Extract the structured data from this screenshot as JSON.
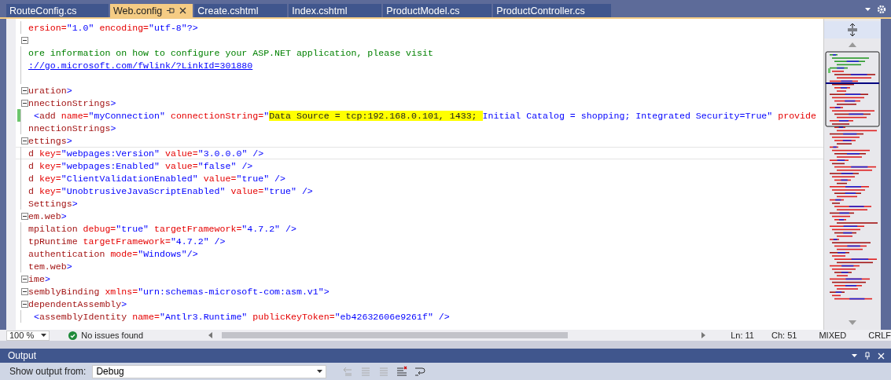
{
  "tabs": [
    {
      "label": "RouteConfig.cs",
      "selected": false
    },
    {
      "label": "Web.config",
      "selected": true
    },
    {
      "label": "Create.cshtml",
      "selected": false
    },
    {
      "label": "Index.cshtml",
      "selected": false
    },
    {
      "label": "ProductModel.cs",
      "selected": false
    },
    {
      "label": "ProductController.cs",
      "selected": false
    }
  ],
  "editor": {
    "lines": [
      {
        "fold": false,
        "changed": false,
        "current": false,
        "segments": [
          {
            "kind": "attr",
            "text": "ersion="
          },
          {
            "kind": "value",
            "text": "\"1.0\" "
          },
          {
            "kind": "attr",
            "text": "encoding="
          },
          {
            "kind": "value",
            "text": "\"utf-8\"?>"
          }
        ]
      },
      {
        "fold": true,
        "changed": false,
        "current": false
      },
      {
        "fold": false,
        "changed": false,
        "current": false,
        "segments": [
          {
            "kind": "comment",
            "text": "ore information on how to configure your ASP.NET application, please visit"
          }
        ]
      },
      {
        "fold": false,
        "changed": false,
        "current": false,
        "segments": [
          {
            "kind": "link",
            "text": "://go.microsoft.com/fwlink/?LinkId=301880"
          }
        ]
      },
      {
        "fold": false,
        "changed": false,
        "current": false
      },
      {
        "fold": true,
        "changed": false,
        "current": false,
        "segments": [
          {
            "kind": "tag",
            "text": "uration"
          },
          {
            "kind": "value",
            "text": ">"
          }
        ]
      },
      {
        "fold": true,
        "changed": false,
        "current": false,
        "segments": [
          {
            "kind": "tag",
            "text": "nnectionStrings"
          },
          {
            "kind": "value",
            "text": ">"
          }
        ]
      },
      {
        "fold": false,
        "changed": true,
        "current": false,
        "segments": [
          {
            "kind": "value",
            "text": " <"
          },
          {
            "kind": "tag",
            "text": "add "
          },
          {
            "kind": "attr",
            "text": "name="
          },
          {
            "kind": "value",
            "text": "\"myConnection\" "
          },
          {
            "kind": "attr",
            "text": "connectionString="
          },
          {
            "kind": "value",
            "text": "\""
          },
          {
            "kind": "highlight",
            "text": "Data Source = tcp:192.168.0.101, 1433; "
          },
          {
            "kind": "value",
            "text": "Initial Catalog = shopping; Integrated Security=True\" "
          },
          {
            "kind": "attr",
            "text": "provide"
          }
        ]
      },
      {
        "fold": false,
        "changed": false,
        "current": false,
        "segments": [
          {
            "kind": "tag",
            "text": "nnectionStrings"
          },
          {
            "kind": "value",
            "text": ">"
          }
        ]
      },
      {
        "fold": true,
        "changed": false,
        "current": false,
        "segments": [
          {
            "kind": "tag",
            "text": "ettings"
          },
          {
            "kind": "value",
            "text": ">"
          }
        ]
      },
      {
        "fold": false,
        "changed": false,
        "current": true,
        "segments": [
          {
            "kind": "tag",
            "text": "d "
          },
          {
            "kind": "attr",
            "text": "key="
          },
          {
            "kind": "value",
            "text": "\"webpages:Version\" "
          },
          {
            "kind": "attr",
            "text": "value="
          },
          {
            "kind": "value",
            "text": "\"3.0.0.0\" />"
          }
        ]
      },
      {
        "fold": false,
        "changed": false,
        "current": false,
        "segments": [
          {
            "kind": "tag",
            "text": "d "
          },
          {
            "kind": "attr",
            "text": "key="
          },
          {
            "kind": "value",
            "text": "\"webpages:Enabled\" "
          },
          {
            "kind": "attr",
            "text": "value="
          },
          {
            "kind": "value",
            "text": "\"false\" />"
          }
        ]
      },
      {
        "fold": false,
        "changed": false,
        "current": false,
        "segments": [
          {
            "kind": "tag",
            "text": "d "
          },
          {
            "kind": "attr",
            "text": "key="
          },
          {
            "kind": "value",
            "text": "\"ClientValidationEnabled\" "
          },
          {
            "kind": "attr",
            "text": "value="
          },
          {
            "kind": "value",
            "text": "\"true\" />"
          }
        ]
      },
      {
        "fold": false,
        "changed": false,
        "current": false,
        "segments": [
          {
            "kind": "tag",
            "text": "d "
          },
          {
            "kind": "attr",
            "text": "key="
          },
          {
            "kind": "value",
            "text": "\"UnobtrusiveJavaScriptEnabled\" "
          },
          {
            "kind": "attr",
            "text": "value="
          },
          {
            "kind": "value",
            "text": "\"true\" />"
          }
        ]
      },
      {
        "fold": false,
        "changed": false,
        "current": false,
        "segments": [
          {
            "kind": "tag",
            "text": "Settings"
          },
          {
            "kind": "value",
            "text": ">"
          }
        ]
      },
      {
        "fold": true,
        "changed": false,
        "current": false,
        "segments": [
          {
            "kind": "tag",
            "text": "em.web"
          },
          {
            "kind": "value",
            "text": ">"
          }
        ]
      },
      {
        "fold": false,
        "changed": false,
        "current": false,
        "segments": [
          {
            "kind": "tag",
            "text": "mpilation "
          },
          {
            "kind": "attr",
            "text": "debug="
          },
          {
            "kind": "value",
            "text": "\"true\" "
          },
          {
            "kind": "attr",
            "text": "targetFramework="
          },
          {
            "kind": "value",
            "text": "\"4.7.2\" />"
          }
        ]
      },
      {
        "fold": false,
        "changed": false,
        "current": false,
        "segments": [
          {
            "kind": "tag",
            "text": "tpRuntime "
          },
          {
            "kind": "attr",
            "text": "targetFramework="
          },
          {
            "kind": "value",
            "text": "\"4.7.2\" />"
          }
        ]
      },
      {
        "fold": false,
        "changed": false,
        "current": false,
        "segments": [
          {
            "kind": "tag",
            "text": "authentication "
          },
          {
            "kind": "attr",
            "text": "mode="
          },
          {
            "kind": "value",
            "text": "\"Windows\"/>"
          }
        ]
      },
      {
        "fold": false,
        "changed": false,
        "current": false,
        "segments": [
          {
            "kind": "tag",
            "text": "tem.web"
          },
          {
            "kind": "value",
            "text": ">"
          }
        ]
      },
      {
        "fold": true,
        "changed": false,
        "current": false,
        "segments": [
          {
            "kind": "tag",
            "text": "ime"
          },
          {
            "kind": "value",
            "text": ">"
          }
        ]
      },
      {
        "fold": true,
        "changed": false,
        "current": false,
        "segments": [
          {
            "kind": "tag",
            "text": "semblyBinding "
          },
          {
            "kind": "attr",
            "text": "xmlns="
          },
          {
            "kind": "value",
            "text": "\"urn:schemas-microsoft-com:asm.v1\">"
          }
        ]
      },
      {
        "fold": true,
        "changed": false,
        "current": false,
        "segments": [
          {
            "kind": "tag",
            "text": "dependentAssembly"
          },
          {
            "kind": "value",
            "text": ">"
          }
        ]
      },
      {
        "fold": false,
        "changed": false,
        "current": false,
        "segments": [
          {
            "kind": "value",
            "text": " <"
          },
          {
            "kind": "tag",
            "text": "assemblyIdentity "
          },
          {
            "kind": "attr",
            "text": "name="
          },
          {
            "kind": "value",
            "text": "\"Antlr3.Runtime\" "
          },
          {
            "kind": "attr",
            "text": "publicKeyToken="
          },
          {
            "kind": "value",
            "text": "\"eb42632606e9261f\" />"
          }
        ]
      }
    ]
  },
  "status": {
    "zoom": "100 %",
    "issues": "No issues found",
    "line": "Ln: 11",
    "column": "Ch: 51",
    "encoding": "MIXED",
    "line_ending": "CRLF"
  },
  "output": {
    "title": "Output",
    "label": "Show output from:",
    "source": "Debug"
  }
}
